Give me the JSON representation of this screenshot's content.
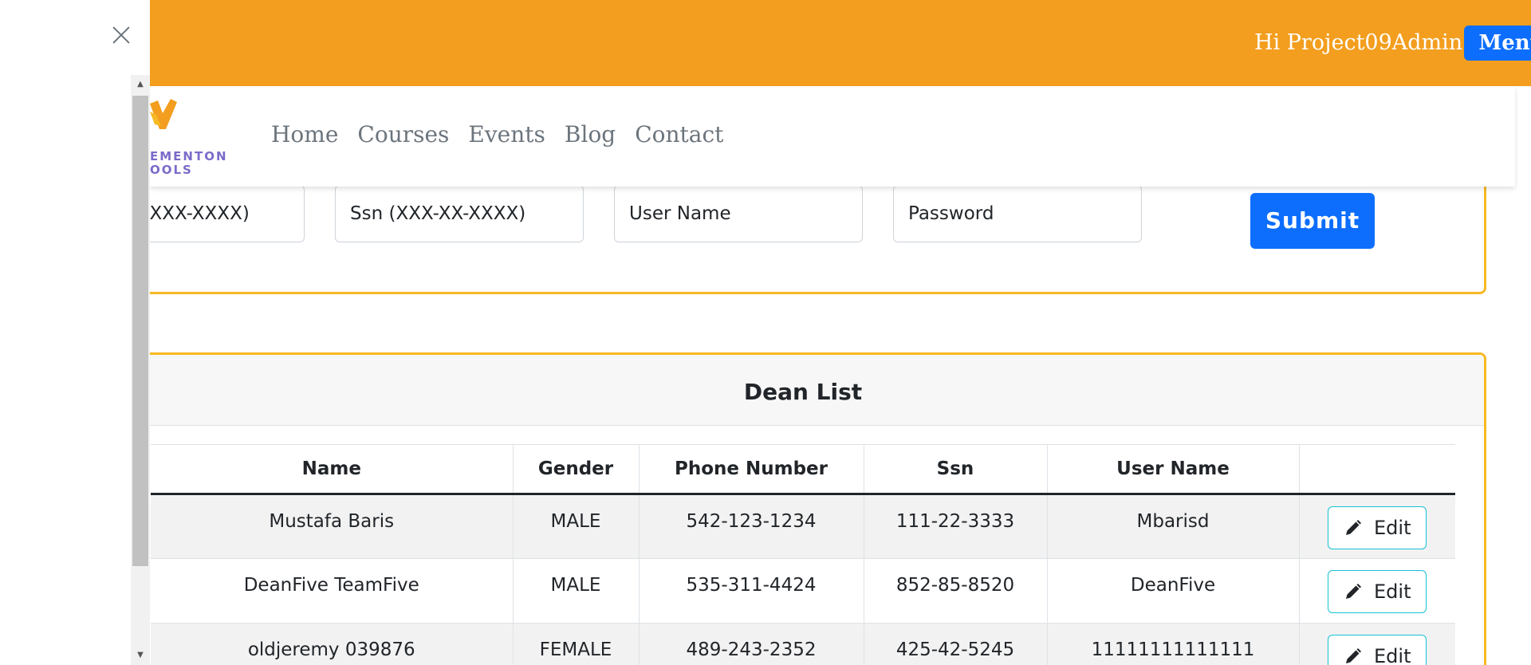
{
  "header": {
    "greeting": "Hi Project09Admin",
    "menu_label": "Menu",
    "brand_color": "#f39e1e"
  },
  "logo": {
    "text_line1": "EMENTON",
    "text_line2": "OOLS"
  },
  "nav": {
    "items": [
      "Home",
      "Courses",
      "Events",
      "Blog",
      "Contact"
    ]
  },
  "form": {
    "phone_placeholder": "XX-XXX-XXXX)",
    "ssn_placeholder": "Ssn (XXX-XX-XXXX)",
    "username_placeholder": "User Name",
    "password_placeholder": "Password",
    "submit_label": "Submit"
  },
  "dean_list": {
    "title": "Dean List",
    "columns": [
      "Name",
      "Gender",
      "Phone Number",
      "Ssn",
      "User Name",
      ""
    ],
    "rows": [
      {
        "name": "Mustafa Baris",
        "gender": "MALE",
        "phone": "542-123-1234",
        "ssn": "111-22-3333",
        "username": "Mbarisd",
        "action": "Edit"
      },
      {
        "name": "DeanFive TeamFive",
        "gender": "MALE",
        "phone": "535-311-4424",
        "ssn": "852-85-8520",
        "username": "DeanFive",
        "action": "Edit"
      },
      {
        "name": "oldjeremy 039876",
        "gender": "FEMALE",
        "phone": "489-243-2352",
        "ssn": "425-42-5245",
        "username": "11111111111111",
        "action": "Edit"
      }
    ]
  },
  "colors": {
    "accent_border": "#f7b924",
    "primary_button": "#0d6efd",
    "edit_border": "#17c1d6"
  }
}
